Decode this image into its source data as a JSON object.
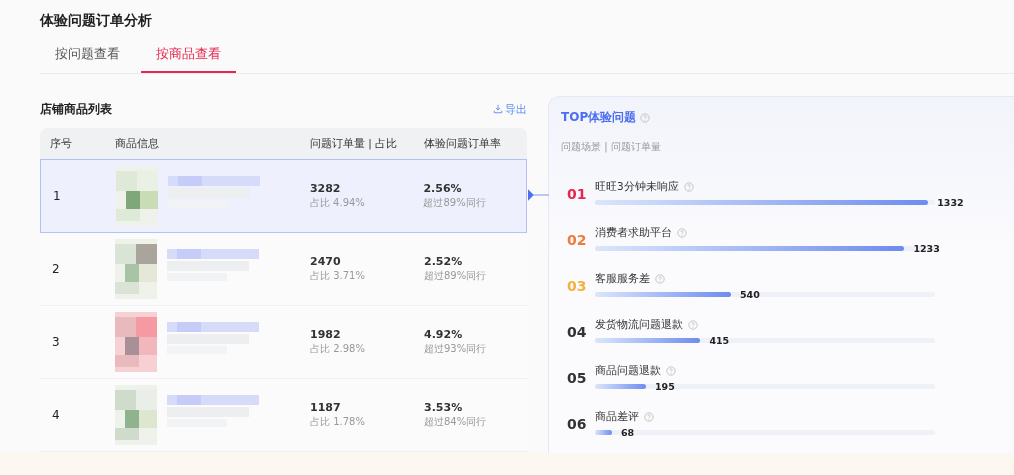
{
  "page_title": "体验问题订单分析",
  "tabs": [
    {
      "label": "按问题查看",
      "selected": false
    },
    {
      "label": "按商品查看",
      "selected": true
    }
  ],
  "product_list": {
    "title": "店铺商品列表",
    "export_link": "导出",
    "columns": [
      "序号",
      "商品信息",
      "问题订单量 | 占比",
      "体验问题订单率"
    ],
    "rows": [
      {
        "index": "1",
        "orders": "3282",
        "share": "占比 4.94%",
        "rate": "2.56%",
        "peer": "超过89%同行",
        "selected": true
      },
      {
        "index": "2",
        "orders": "2470",
        "share": "占比 3.71%",
        "rate": "2.52%",
        "peer": "超过89%同行",
        "selected": false
      },
      {
        "index": "3",
        "orders": "1982",
        "share": "占比 2.98%",
        "rate": "4.92%",
        "peer": "超过93%同行",
        "selected": false
      },
      {
        "index": "4",
        "orders": "1187",
        "share": "占比 1.78%",
        "rate": "3.53%",
        "peer": "超过84%同行",
        "selected": false
      }
    ]
  },
  "top_issues": {
    "title": "TOP体验问题",
    "subtitle": "问题场景 | 问题订单量",
    "items": [
      {
        "rank": "01",
        "name": "旺旺3分钟未响应",
        "value": "1332",
        "level": 0.98,
        "color": "#e8264f"
      },
      {
        "rank": "02",
        "name": "消费者求助平台",
        "value": "1233",
        "level": 0.91,
        "color": "#f07a3a"
      },
      {
        "rank": "03",
        "name": "客服服务差",
        "value": "540",
        "level": 0.4,
        "color": "#f5b13d"
      },
      {
        "rank": "04",
        "name": "发货物流问题退款",
        "value": "415",
        "level": 0.31,
        "color": "#333333"
      },
      {
        "rank": "05",
        "name": "商品问题退款",
        "value": "195",
        "level": 0.15,
        "color": "#333333"
      },
      {
        "rank": "06",
        "name": "商品差评",
        "value": "68",
        "level": 0.05,
        "color": "#333333"
      }
    ]
  }
}
